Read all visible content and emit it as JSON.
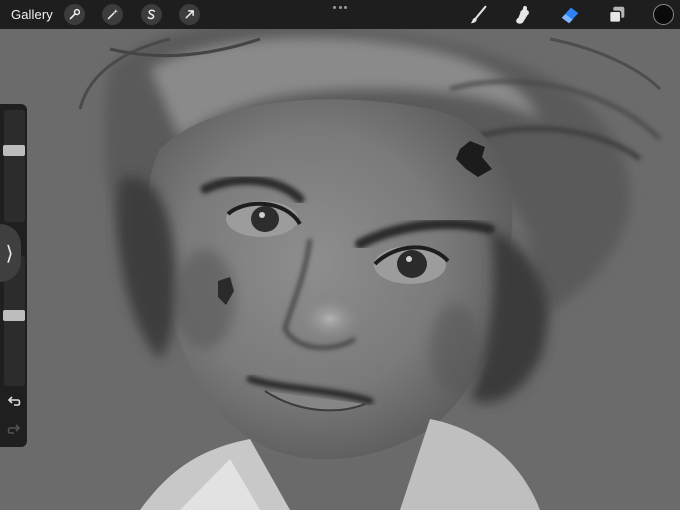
{
  "toolbar": {
    "gallery_label": "Gallery",
    "left_tools": [
      "wrench-icon",
      "magic-wand-icon",
      "selection-s-icon",
      "transform-arrow-icon"
    ],
    "more_menu": "more-dots-icon",
    "right_tools": [
      "brush-icon",
      "smudge-icon",
      "eraser-icon",
      "layers-icon"
    ],
    "active_tool": "eraser",
    "accent_color": "#2d82f5",
    "current_color": "#0a0a0a"
  },
  "sidebar": {
    "brush_size": 0.65,
    "brush_opacity": 0.55,
    "collapse_glyph": "⟩"
  },
  "canvas": {
    "background": "#6b6b6b"
  }
}
